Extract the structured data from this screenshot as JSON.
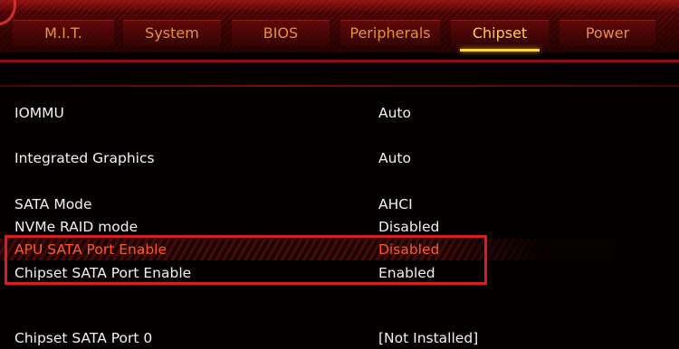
{
  "header": {
    "tabs": [
      {
        "label": "M.I.T.",
        "active": false
      },
      {
        "label": "System",
        "active": false
      },
      {
        "label": "BIOS",
        "active": false
      },
      {
        "label": "Peripherals",
        "active": false
      },
      {
        "label": "Chipset",
        "active": true
      },
      {
        "label": "Power",
        "active": false
      }
    ]
  },
  "settings": [
    {
      "label": "IOMMU",
      "value": "Auto"
    },
    {
      "label": "Integrated Graphics",
      "value": "Auto"
    },
    {
      "label": "SATA Mode",
      "value": "AHCI"
    },
    {
      "label": "NVMe RAID mode",
      "value": "Disabled"
    },
    {
      "label": "APU SATA Port Enable",
      "value": "Disabled",
      "selected": true
    },
    {
      "label": "Chipset SATA Port Enable",
      "value": "Enabled"
    },
    {
      "label": "Chipset SATA Port 0",
      "value": "[Not Installed]"
    }
  ],
  "colors": {
    "background": "#050101",
    "tab_inactive_text": "#e8903a",
    "tab_active_text": "#ffd23a",
    "selected_text": "#ff5a26",
    "annotation_box": "#d81f1f",
    "header_red": "#6a0808"
  },
  "icons": {
    "corner_decoration": "ring-icon"
  }
}
